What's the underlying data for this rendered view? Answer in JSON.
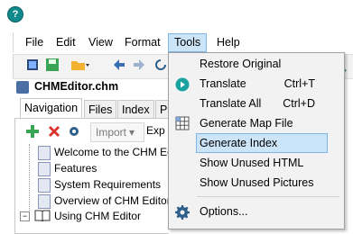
{
  "menubar": {
    "items": [
      "File",
      "Edit",
      "View",
      "Format",
      "Tools",
      "Help"
    ]
  },
  "document_tab": {
    "title": "CHMEditor.chm"
  },
  "panel_tabs": [
    "Navigation",
    "Files",
    "Index",
    "Pr"
  ],
  "panel_toolbar": {
    "import_label": "Import",
    "export_label": "Exp"
  },
  "nav_list": {
    "items": [
      "Welcome to the CHM Edito",
      "Features",
      "System Requirements",
      "Overview of CHM Editor",
      "Using CHM Editor"
    ]
  },
  "tools_menu": {
    "items": [
      {
        "label": "Restore Original",
        "shortcut": ""
      },
      {
        "label": "Translate",
        "shortcut": "Ctrl+T"
      },
      {
        "label": "Translate All",
        "shortcut": "Ctrl+D"
      },
      {
        "label": "Generate Map File",
        "shortcut": ""
      },
      {
        "label": "Generate Index",
        "shortcut": ""
      },
      {
        "label": "Show Unused HTML",
        "shortcut": ""
      },
      {
        "label": "Show Unused Pictures",
        "shortcut": ""
      },
      {
        "label": "Options...",
        "shortcut": ""
      }
    ]
  },
  "icons": {
    "app": "help-question-icon",
    "translate": "play-icon",
    "map": "grid-icon",
    "options": "gear-icon",
    "add": "plus-icon",
    "delete": "x-icon",
    "settings": "gear-icon",
    "book": "book-icon",
    "page": "page-icon"
  },
  "colors": {
    "highlight": "#cce4f7",
    "highlight_border": "#7fb6e6",
    "menu_bg": "#f2f2f2",
    "add_green": "#3aa655",
    "delete_red": "#d9342b",
    "play_teal": "#1aa1a1"
  }
}
